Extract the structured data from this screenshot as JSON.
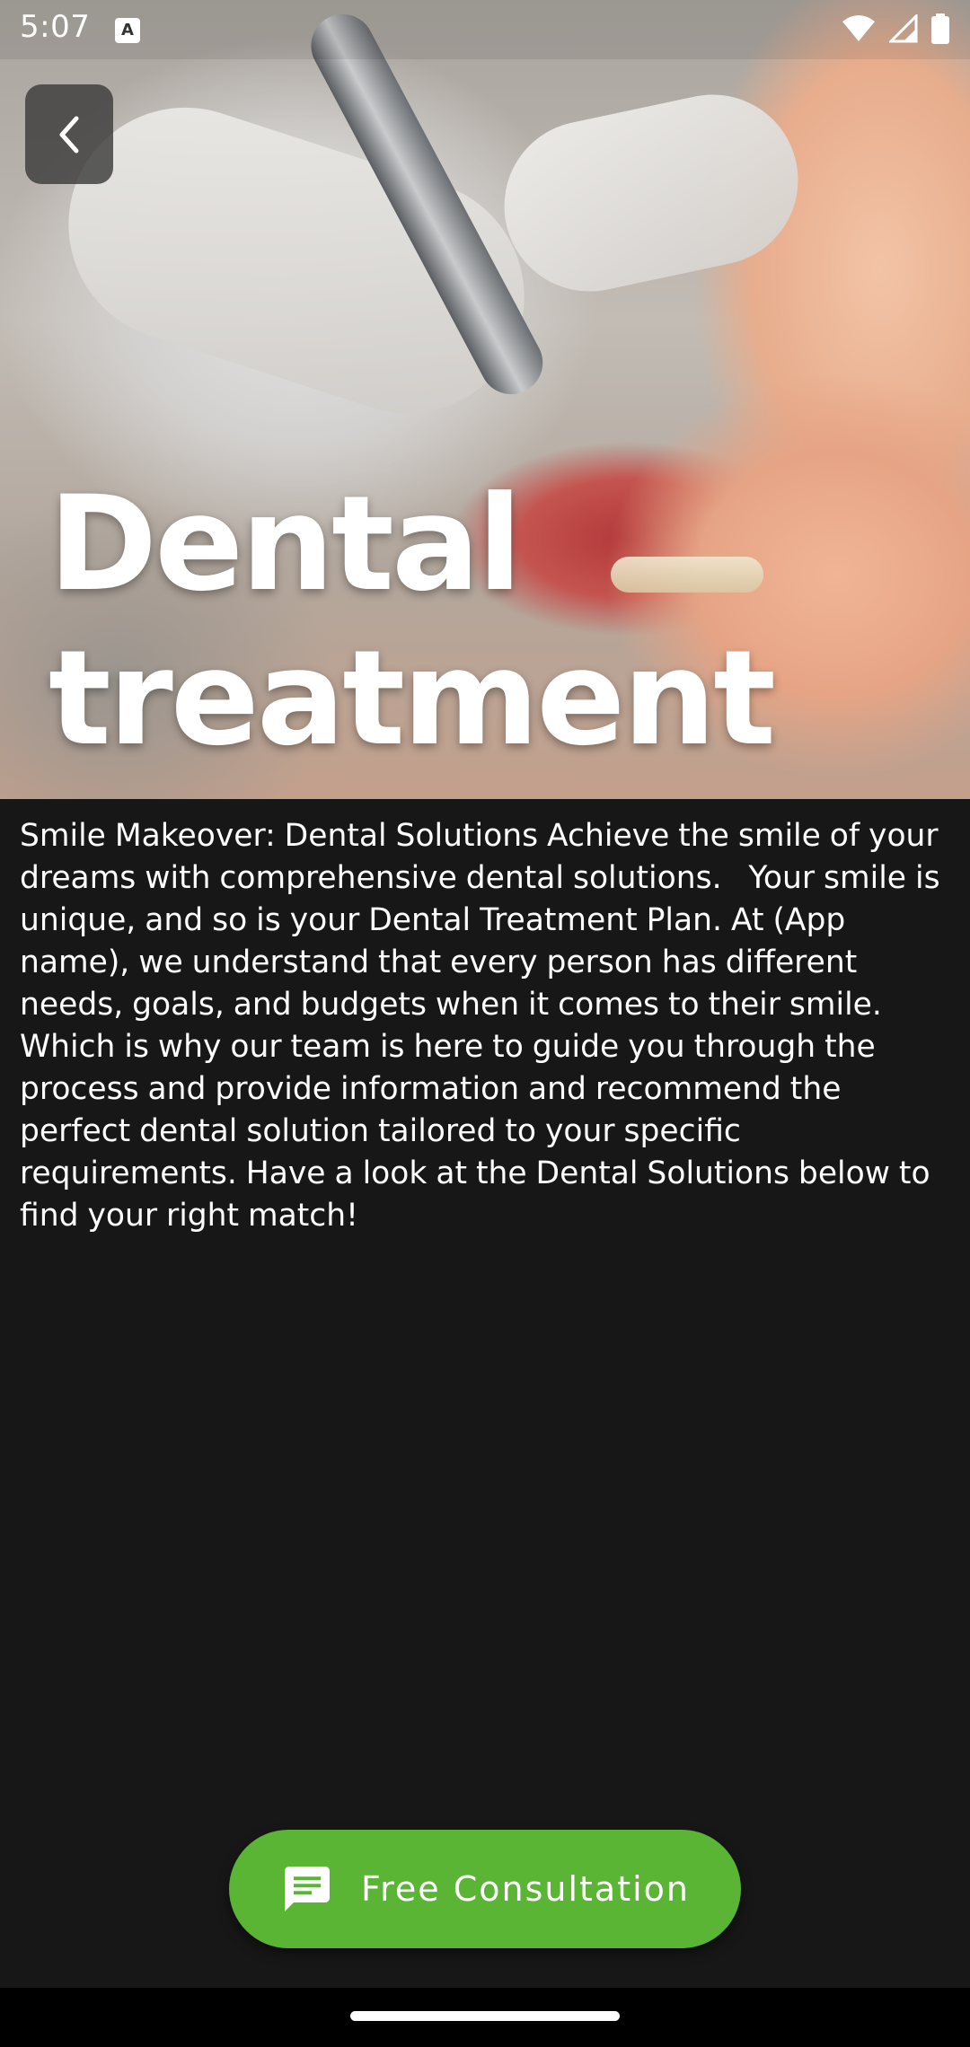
{
  "status_bar": {
    "time": "5:07",
    "icons": [
      "notification-a-icon",
      "wifi-icon",
      "cell-signal-icon",
      "battery-icon"
    ]
  },
  "header": {
    "back_icon": "chevron-left-icon",
    "title": "Dental treatment"
  },
  "main": {
    "description": "Smile Makeover: Dental Solutions Achieve the smile of your dreams with comprehensive dental solutions.   Your smile is unique, and so is your Dental Treatment Plan. At (App name), we understand that every person has different needs, goals, and budgets when it comes to their smile. Which is why our team is here to guide you through the process and provide information and recommend the perfect dental solution tailored to your specific requirements. Have a look at the Dental Solutions below to find your right match!"
  },
  "cta": {
    "label": "Free Consultation",
    "icon": "chat-message-icon",
    "color": "#5bb535"
  },
  "colors": {
    "background": "#171717",
    "text": "#ffffff",
    "accent": "#5bb535"
  }
}
